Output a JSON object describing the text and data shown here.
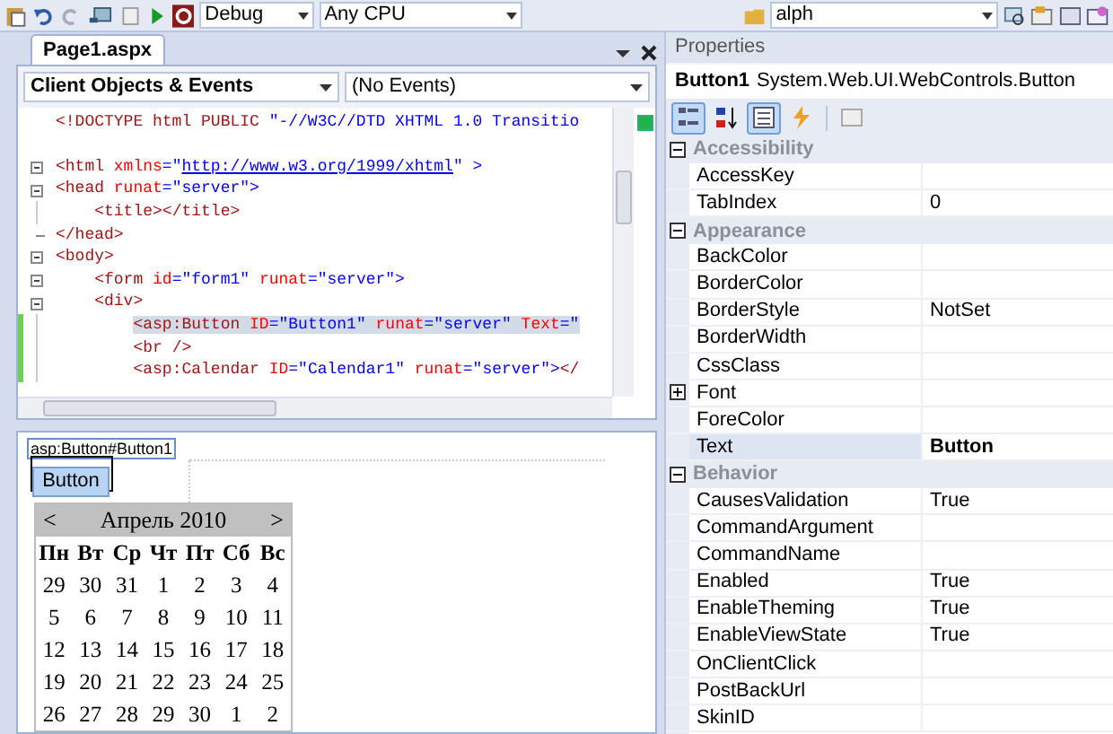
{
  "toolbar": {
    "config": "Debug",
    "platform": "Any CPU",
    "find": "alph"
  },
  "document_tab": {
    "label": "Page1.aspx",
    "selected": true
  },
  "dropdowns": {
    "objects": "Client Objects & Events",
    "events": "(No Events)"
  },
  "code_lines": [
    {
      "kind": "top",
      "changed": false,
      "highlighted": false,
      "tokens": [
        {
          "kind": "tag",
          "text": "<!DOCTYPE html PUBLIC "
        },
        {
          "kind": "value",
          "text": "\"-//W3C//DTD XHTML 1.0 Transitio"
        }
      ]
    },
    {
      "kind": "blank"
    },
    {
      "kind": "block",
      "changed": false,
      "highlighted": false,
      "tokens": [
        {
          "kind": "tag",
          "text": "<html "
        },
        {
          "kind": "attr",
          "text": "xmlns"
        },
        {
          "kind": "value",
          "text": "=\""
        },
        {
          "kind": "link",
          "text": "http://www.w3.org/1999/xhtml"
        },
        {
          "kind": "value",
          "text": "\" >"
        }
      ]
    },
    {
      "kind": "block",
      "changed": false,
      "highlighted": false,
      "tokens": [
        {
          "kind": "tag",
          "text": "<head "
        },
        {
          "kind": "attr",
          "text": "runat"
        },
        {
          "kind": "value",
          "text": "=\"server\">"
        }
      ]
    },
    {
      "kind": "inner",
      "changed": false,
      "highlighted": false,
      "tokens": [
        {
          "kind": "tag",
          "text": "    <title></title>"
        }
      ]
    },
    {
      "kind": "block_end",
      "changed": false,
      "highlighted": false,
      "tokens": [
        {
          "kind": "tag",
          "text": "</head>"
        }
      ]
    },
    {
      "kind": "block",
      "changed": false,
      "highlighted": false,
      "tokens": [
        {
          "kind": "tag",
          "text": "<body>"
        }
      ]
    },
    {
      "kind": "block",
      "changed": false,
      "highlighted": false,
      "tokens": [
        {
          "kind": "tag",
          "text": "    <form "
        },
        {
          "kind": "attr",
          "text": "id"
        },
        {
          "kind": "value",
          "text": "=\"form1\" "
        },
        {
          "kind": "attr",
          "text": "runat"
        },
        {
          "kind": "value",
          "text": "=\"server\">"
        }
      ]
    },
    {
      "kind": "block",
      "changed": false,
      "highlighted": false,
      "tokens": [
        {
          "kind": "tag",
          "text": "    <div>"
        }
      ]
    },
    {
      "kind": "inner",
      "changed": true,
      "highlighted": true,
      "tokens": [
        {
          "kind": "tag",
          "text": "        <asp:Button "
        },
        {
          "kind": "attr",
          "text": "ID"
        },
        {
          "kind": "value",
          "text": "=\"Button1\" "
        },
        {
          "kind": "attr",
          "text": "runat"
        },
        {
          "kind": "value",
          "text": "=\"server\" "
        },
        {
          "kind": "attr",
          "text": "Text"
        },
        {
          "kind": "value",
          "text": "=\""
        }
      ]
    },
    {
      "kind": "inner",
      "changed": true,
      "highlighted": false,
      "tokens": [
        {
          "kind": "tag",
          "text": "        <br />"
        }
      ]
    },
    {
      "kind": "inner",
      "changed": true,
      "highlighted": false,
      "tokens": [
        {
          "kind": "tag",
          "text": "        <asp:Calendar "
        },
        {
          "kind": "attr",
          "text": "ID"
        },
        {
          "kind": "value",
          "text": "=\"Calendar1\" "
        },
        {
          "kind": "attr",
          "text": "runat"
        },
        {
          "kind": "value",
          "text": "=\"server\">"
        },
        {
          "kind": "tag",
          "text": "</"
        }
      ]
    }
  ],
  "design": {
    "tag": "asp:Button#Button1",
    "button": "Button",
    "calendar": {
      "prev": "<",
      "title": "Апрель 2010",
      "next": ">",
      "weekdays": [
        "Пн",
        "Вт",
        "Ср",
        "Чт",
        "Пт",
        "Сб",
        "Вс"
      ],
      "weeks": [
        [
          "29",
          "30",
          "31",
          "1",
          "2",
          "3",
          "4"
        ],
        [
          "5",
          "6",
          "7",
          "8",
          "9",
          "10",
          "11"
        ],
        [
          "12",
          "13",
          "14",
          "15",
          "16",
          "17",
          "18"
        ],
        [
          "19",
          "20",
          "21",
          "22",
          "23",
          "24",
          "25"
        ],
        [
          "26",
          "27",
          "28",
          "29",
          "30",
          "1",
          "2"
        ]
      ]
    }
  },
  "properties": {
    "title": "Properties",
    "object_name": "Button1",
    "object_type": "System.Web.UI.WebControls.Button",
    "tools": [
      {
        "kind": "categorized",
        "selected": true
      },
      {
        "kind": "alphabetical",
        "selected": false
      },
      {
        "kind": "properties",
        "selected": true
      },
      {
        "kind": "events",
        "selected": false
      },
      {
        "kind": "pages",
        "selected": false
      }
    ],
    "rows": [
      {
        "kind": "category",
        "name": "Accessibility",
        "expanded": true
      },
      {
        "kind": "property",
        "name": "AccessKey",
        "selected": false
      },
      {
        "kind": "property",
        "name": "TabIndex",
        "value": "0",
        "selected": false,
        "modified": false
      },
      {
        "kind": "category",
        "name": "Appearance",
        "expanded": true
      },
      {
        "kind": "property",
        "name": "BackColor",
        "selected": false
      },
      {
        "kind": "property",
        "name": "BorderColor",
        "selected": false
      },
      {
        "kind": "property",
        "name": "BorderStyle",
        "value": "NotSet",
        "selected": false,
        "modified": false
      },
      {
        "kind": "property",
        "name": "BorderWidth",
        "selected": false
      },
      {
        "kind": "property",
        "name": "CssClass",
        "selected": false
      },
      {
        "kind": "property",
        "name": "Font",
        "selected": false,
        "expanded": false
      },
      {
        "kind": "property",
        "name": "ForeColor",
        "selected": false
      },
      {
        "kind": "property",
        "name": "Text",
        "value": "Button",
        "selected": true,
        "modified": true
      },
      {
        "kind": "category",
        "name": "Behavior",
        "expanded": true
      },
      {
        "kind": "property",
        "name": "CausesValidation",
        "value": "True",
        "selected": false,
        "modified": false
      },
      {
        "kind": "property",
        "name": "CommandArgument",
        "selected": false
      },
      {
        "kind": "property",
        "name": "CommandName",
        "selected": false
      },
      {
        "kind": "property",
        "name": "Enabled",
        "value": "True",
        "selected": false,
        "modified": false
      },
      {
        "kind": "property",
        "name": "EnableTheming",
        "value": "True",
        "selected": false,
        "modified": false
      },
      {
        "kind": "property",
        "name": "EnableViewState",
        "value": "True",
        "selected": false,
        "modified": false
      },
      {
        "kind": "property",
        "name": "OnClientClick",
        "selected": false
      },
      {
        "kind": "property",
        "name": "PostBackUrl",
        "selected": false
      },
      {
        "kind": "property",
        "name": "SkinID",
        "selected": false
      }
    ]
  }
}
